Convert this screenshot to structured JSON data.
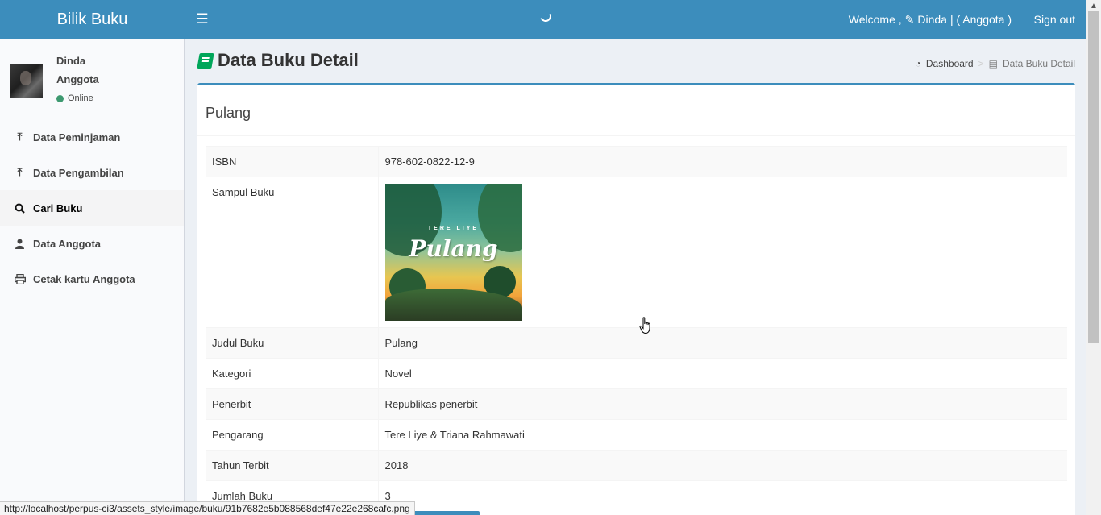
{
  "app": {
    "title": "Bilik Buku"
  },
  "header": {
    "welcome_prefix": "Welcome ,",
    "user_name": "Dinda",
    "user_role": "| ( Anggota )",
    "signout_label": "Sign out"
  },
  "sidebar": {
    "user": {
      "name": "Dinda",
      "role": "Anggota",
      "status": "Online"
    },
    "items": [
      {
        "label": "Data Peminjaman",
        "icon": "upload-icon"
      },
      {
        "label": "Data Pengambilan",
        "icon": "upload-icon"
      },
      {
        "label": "Cari Buku",
        "icon": "search-icon"
      },
      {
        "label": "Data Anggota",
        "icon": "user-icon"
      },
      {
        "label": "Cetak kartu Anggota",
        "icon": "print-icon"
      }
    ]
  },
  "page": {
    "title": "Data Buku Detail",
    "breadcrumb": {
      "home": "Dashboard",
      "current": "Data Buku Detail"
    }
  },
  "book": {
    "box_title": "Pulang",
    "rows": [
      {
        "label": "ISBN",
        "value": "978-602-0822-12-9"
      },
      {
        "label": "Sampul Buku",
        "cover_author": "TERE LIYE",
        "cover_title": "Pulang"
      },
      {
        "label": "Judul Buku",
        "value": "Pulang"
      },
      {
        "label": "Kategori",
        "value": "Novel"
      },
      {
        "label": "Penerbit",
        "value": "Republikas penerbit"
      },
      {
        "label": "Pengarang",
        "value": "Tere Liye & Triana Rahmawati"
      },
      {
        "label": "Tahun Terbit",
        "value": "2018"
      },
      {
        "label": "Jumlah Buku",
        "value": "3"
      }
    ]
  },
  "statusbar": {
    "url": "http://localhost/perpus-ci3/assets_style/image/buku/91b7682e5b088568def47e22e268cafc.png"
  },
  "colors": {
    "header": "#3c8dbc",
    "accent_green": "#00a65a",
    "online": "#3d9970"
  }
}
